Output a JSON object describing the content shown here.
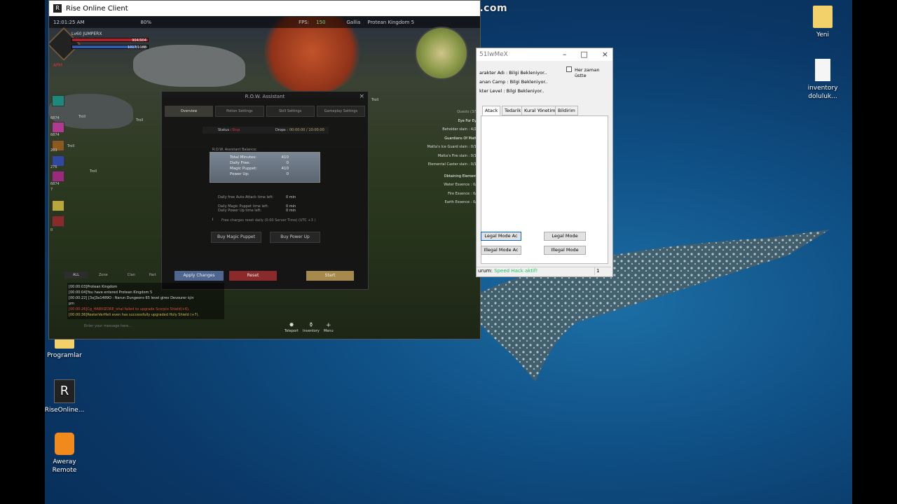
{
  "watermark": "www.BANDICAM.com",
  "desktop": {
    "icons": [
      {
        "label": "Yeni",
        "icon": "folder-icon"
      },
      {
        "label": "inventory doluluk...",
        "icon": "file-icon"
      },
      {
        "label": "Programlar",
        "icon": "folder-icon"
      },
      {
        "label": "RiseOnline...",
        "icon": "rise-shortcut-icon"
      },
      {
        "label": "Aweray Remote",
        "icon": "aweray-icon"
      }
    ]
  },
  "game_window": {
    "title": "Rise Online Client",
    "hud": {
      "clock": "12:01:25 AM",
      "zoom": "80%",
      "fps_label": "FPS:",
      "fps_value": "150",
      "server_location": "Gallia",
      "server_name": "Protean Kingdom 5",
      "char_level_name": "Lv60 JUMPERX",
      "hp": "904/904",
      "mp": "1017/1188",
      "hp_fraction": 1.0,
      "mp_fraction": 0.856,
      "mode_label": "APM",
      "skill_counts": [
        "6874",
        "6874",
        "203",
        "276",
        "6874",
        "7",
        "0"
      ]
    },
    "npc_labels": [
      "Troll",
      "Troll",
      "Troll",
      "Troll",
      "Troll"
    ],
    "quests": {
      "header": "Quests (3/5)",
      "items": [
        {
          "title": "Eye For Eye",
          "objectives": [
            "Beholder slain : 4/20"
          ]
        },
        {
          "title": "Guardians Of Matta",
          "objectives": [
            "Matta's Ice Guard slain : 0/10",
            "Matta's Fire slain : 0/10",
            "Elemental Caster slain : 0/10"
          ]
        },
        {
          "title": "Obtaining Elements",
          "objectives": [
            "Water Essence : 0/1",
            "Fire Essence : 0/1",
            "Earth Essence : 0/1"
          ]
        }
      ]
    },
    "row_assistant": {
      "title": "R.O.W. Assistant",
      "tabs": [
        "Overview",
        "Potion Settings",
        "Skill Settings",
        "Gameplay Settings"
      ],
      "active_tab": "Overview",
      "status_label": "Status :",
      "status_value": "Stop",
      "drops_label": "Drops :",
      "drops_value": "00:00:00 / 10:00:00",
      "balance_title": "R.O.W. Assistant Balance:",
      "balance": [
        {
          "label": "Total Minutes:",
          "value": "410"
        },
        {
          "label": "Daily Free:",
          "value": "0"
        },
        {
          "label": "Magic Puppet:",
          "value": "410"
        },
        {
          "label": "Power Up:",
          "value": "0"
        }
      ],
      "time_left": [
        {
          "label": "Daily free Auto-Attack time left:",
          "value": "0 min"
        },
        {
          "label": "Daily Magic Puppet time left:",
          "value": "0 min"
        },
        {
          "label": "Daily Power Up time left:",
          "value": "0 min"
        }
      ],
      "reset_note": "Free charges reset daily (0:00 Server Time) (UTC +3 )",
      "buy_magic_puppet": "Buy Magic Puppet",
      "buy_power_up": "Buy Power Up",
      "apply_changes": "Apply Changes",
      "reset": "Reset",
      "start": "Start"
    },
    "chat": {
      "tabs": [
        "ALL",
        "Zone",
        "Clan",
        "Part"
      ],
      "lines": [
        {
          "text": "[00:00:03]Protean Kingdom",
          "color": "#d8d8d8"
        },
        {
          "text": "[00:00:04]You have entered Protean Kingdom 5",
          "color": "#d8d8d8"
        },
        {
          "text": "[00:00:22] [3a]3a1489O : Narun Dungeons 65 level girev Devourer için",
          "color": "#d8d8d8"
        },
        {
          "text": "pm",
          "color": "#d8d8d8"
        },
        {
          "text": "[00:00:26]Cg_HARVIZORE_ohal failed to upgrade Scorpio Shield(+6).",
          "color": "#e04a3a"
        },
        {
          "text": "[00:00:36]ResterVerHeli even has successfully upgraded Holy Shield (+7).",
          "color": "#d9b84a"
        }
      ],
      "placeholder": "Enter your message here..."
    },
    "bottom_menu": [
      "Teleport",
      "Inventory",
      "Menu"
    ]
  },
  "trainer": {
    "title": "51lwMeX",
    "always_on_top": "Her zaman üstte",
    "info": [
      "arakter Adı : Bilgi Bekleniyor..",
      "anan Camp : Bilgi Bekleniyor..",
      "kter Level : Bilgi Bekleniyor.."
    ],
    "tabs": [
      "Atack",
      "Tedarik",
      "Kural Yönetimi",
      "Bildirim"
    ],
    "active_tab": "Atack",
    "buttons": [
      "Legal Mode Ac",
      "Legal Mode",
      "Illegal Mode Ac",
      "Illegal Mode"
    ],
    "status_label": "urum:",
    "status_value": "Speed Hack aktif!",
    "status_color": "#22c55e",
    "status_field": "1"
  }
}
